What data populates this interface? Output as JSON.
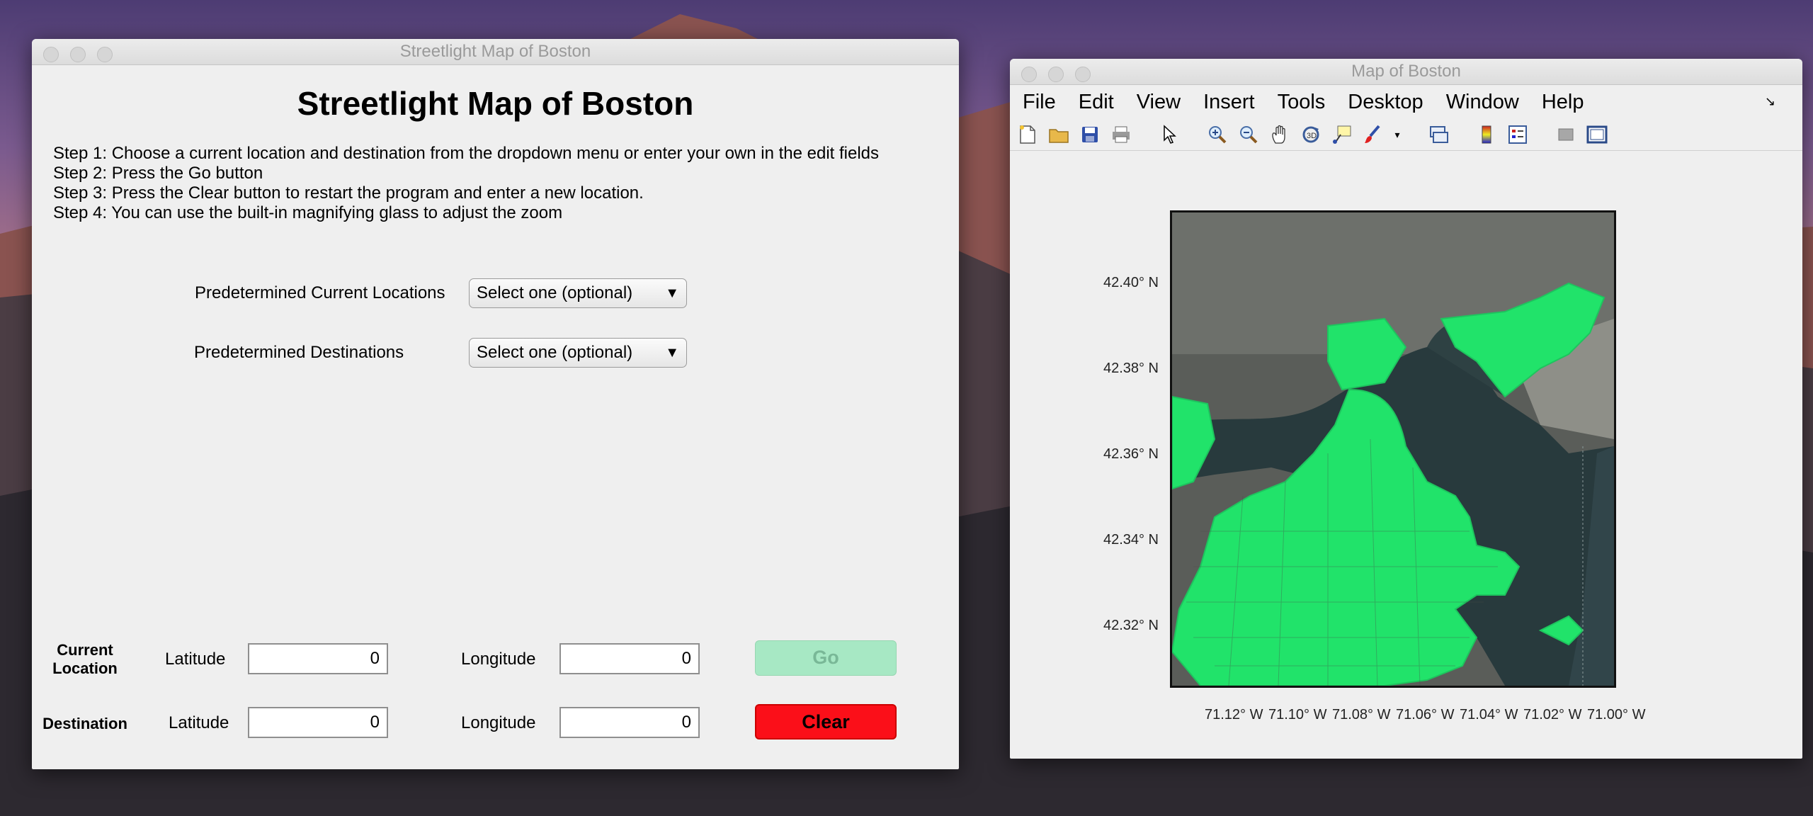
{
  "left_window": {
    "title": "Streetlight Map of Boston",
    "heading": "Streetlight Map of Boston",
    "steps": [
      "Step 1: Choose a current location and destination from the dropdown menu or enter your own in the edit fields",
      "Step 2: Press the Go button",
      "Step 3: Press the Clear button to restart the program and enter a new location.",
      "Step 4: You can use the built-in magnifying glass to adjust the zoom"
    ],
    "current_locations_label": "Predetermined Current Locations",
    "current_locations_value": "Select one (optional)",
    "destinations_label": "Predetermined Destinations",
    "destinations_value": "Select one (optional)",
    "current_location_label_1": "Current",
    "current_location_label_2": "Location",
    "destination_label": "Destination",
    "latitude_label": "Latitude",
    "longitude_label": "Longitude",
    "current_lat": "0",
    "current_lon": "0",
    "dest_lat": "0",
    "dest_lon": "0",
    "go_label": "Go",
    "clear_label": "Clear"
  },
  "right_window": {
    "title": "Map of Boston",
    "menu": [
      "File",
      "Edit",
      "View",
      "Insert",
      "Tools",
      "Desktop",
      "Window",
      "Help"
    ],
    "toolbar_icons": [
      "new-figure-icon",
      "open-icon",
      "save-icon",
      "print-icon",
      "pointer-icon",
      "zoom-in-icon",
      "zoom-out-icon",
      "pan-icon",
      "rotate-icon",
      "data-cursor-icon",
      "brush-icon",
      "link-icon",
      "colorbar-icon",
      "legend-icon",
      "hide-tools-icon",
      "show-tools-icon"
    ],
    "y_ticks": [
      "42.40° N",
      "42.38° N",
      "42.36° N",
      "42.34° N",
      "42.32° N"
    ],
    "x_ticks": [
      "71.12° W",
      "71.10° W",
      "71.08° W",
      "71.06° W",
      "71.04° W",
      "71.02° W",
      "71.00° W"
    ],
    "colors": {
      "streetlights": "#21e36a",
      "go_button": "#a7e8c4",
      "clear_button": "#fb0f19"
    }
  }
}
